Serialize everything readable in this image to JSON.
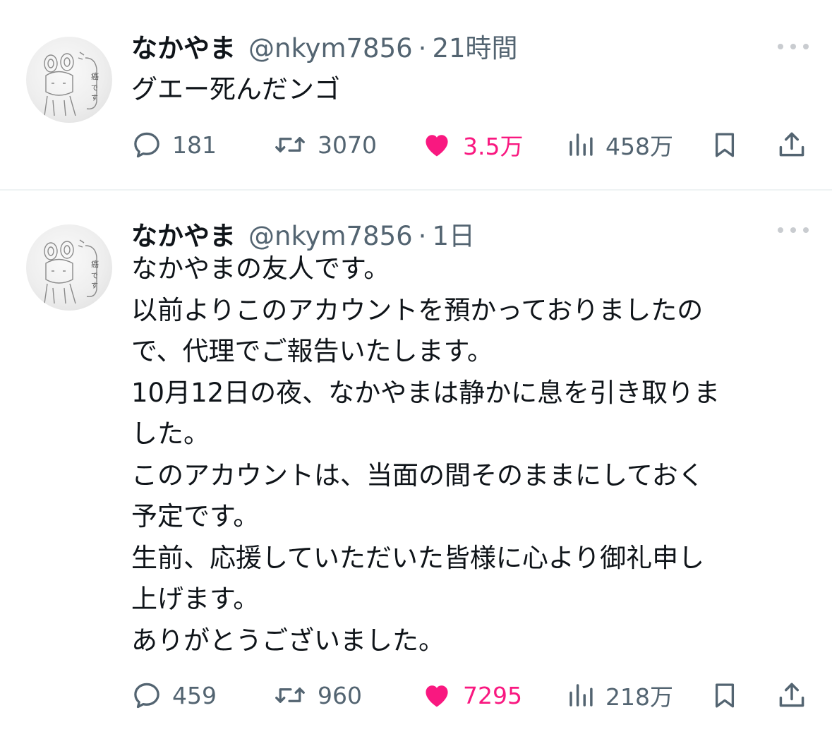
{
  "colors": {
    "text": "#0f1419",
    "secondary": "#536471",
    "like": "#f91880",
    "divider": "#eff3f4"
  },
  "icons": {
    "reply": "speech-bubble-icon",
    "retweet": "retweet-arrows-icon",
    "like": "heart-filled-icon",
    "views": "bar-chart-icon",
    "bookmark": "bookmark-icon",
    "share": "share-upload-icon",
    "more": "three-dots-icon"
  },
  "tweets": [
    {
      "name": "なかやま",
      "handle": "@nkym7856",
      "separator": "·",
      "time": "21時間",
      "text": "グエー死んだンゴ",
      "replies": "181",
      "retweets": "3070",
      "likes": "3.5万",
      "views": "458万",
      "liked": true
    },
    {
      "name": "なかやま",
      "handle": "@nkym7856",
      "separator": "·",
      "time": "1日",
      "text": "なかやまの友人です。\n以前よりこのアカウントを預かっておりましたの\nで、代理でご報告いたします。\n10月12日の夜、なかやまは静かに息を引き取りま\nした。\nこのアカウントは、当面の間そのままにしておく\n予定です。\n生前、応援していただいた皆様に心より御礼申し\n上げます。\nありがとうございました。",
      "replies": "459",
      "retweets": "960",
      "likes": "7295",
      "views": "218万",
      "liked": true
    }
  ]
}
